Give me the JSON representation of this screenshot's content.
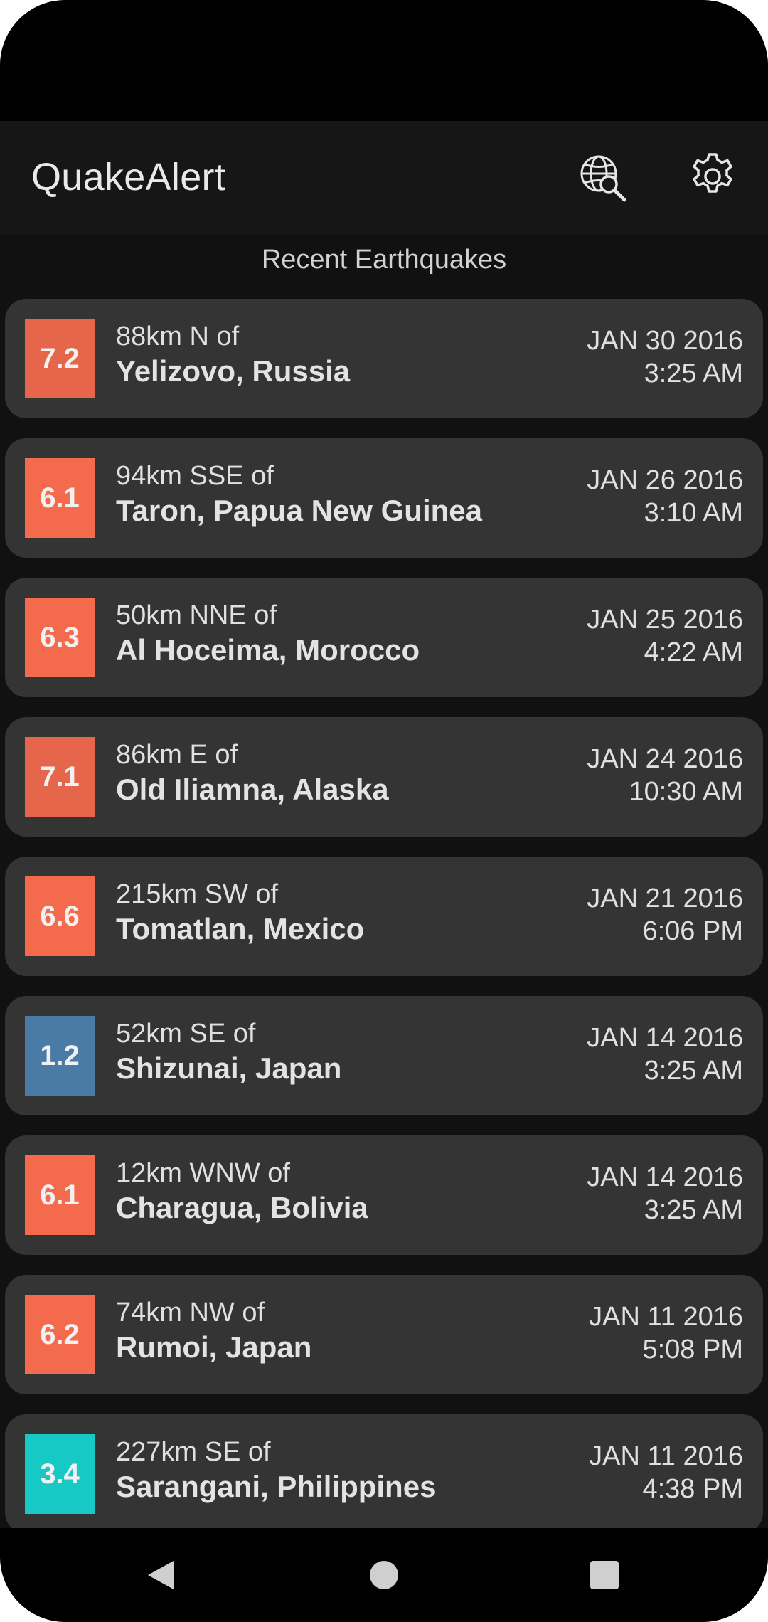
{
  "app": {
    "title": "QuakeAlert",
    "search_icon": "globe-search-icon",
    "settings_icon": "gear-icon"
  },
  "list_title": "Recent Earthquakes",
  "colors": {
    "background": "#111111",
    "card": "#343434",
    "mag_high": "#f0694d",
    "mag_low_blue": "#4a7aa6",
    "mag_low_teal": "#17c9c5"
  },
  "quakes": [
    {
      "mag": "7.2",
      "color": "#e5664a",
      "offset": "88km N of",
      "place": "Yelizovo, Russia",
      "date": "JAN 30 2016",
      "time": "3:25 AM"
    },
    {
      "mag": "6.1",
      "color": "#f46a4c",
      "offset": "94km SSE of",
      "place": "Taron, Papua New Guinea",
      "date": "JAN 26 2016",
      "time": "3:10 AM"
    },
    {
      "mag": "6.3",
      "color": "#f46a4c",
      "offset": "50km NNE of",
      "place": "Al Hoceima, Morocco",
      "date": "JAN 25 2016",
      "time": "4:22 AM"
    },
    {
      "mag": "7.1",
      "color": "#e5664a",
      "offset": "86km E of",
      "place": "Old Iliamna, Alaska",
      "date": "JAN 24 2016",
      "time": "10:30 AM"
    },
    {
      "mag": "6.6",
      "color": "#f46a4c",
      "offset": "215km SW of",
      "place": "Tomatlan, Mexico",
      "date": "JAN 21 2016",
      "time": "6:06 PM"
    },
    {
      "mag": "1.2",
      "color": "#4a7aa6",
      "offset": "52km SE of",
      "place": "Shizunai, Japan",
      "date": "JAN 14 2016",
      "time": "3:25 AM"
    },
    {
      "mag": "6.1",
      "color": "#f46a4c",
      "offset": "12km WNW of",
      "place": "Charagua, Bolivia",
      "date": "JAN 14 2016",
      "time": "3:25 AM"
    },
    {
      "mag": "6.2",
      "color": "#f46a4c",
      "offset": "74km NW of",
      "place": "Rumoi, Japan",
      "date": "JAN 11 2016",
      "time": "5:08 PM"
    },
    {
      "mag": "3.4",
      "color": "#17c9c5",
      "offset": "227km SE of",
      "place": "Sarangani, Philippines",
      "date": "JAN 11 2016",
      "time": "4:38 PM"
    }
  ],
  "nav": {
    "back_icon": "back-triangle-icon",
    "home_icon": "home-circle-icon",
    "recent_icon": "recents-square-icon"
  }
}
